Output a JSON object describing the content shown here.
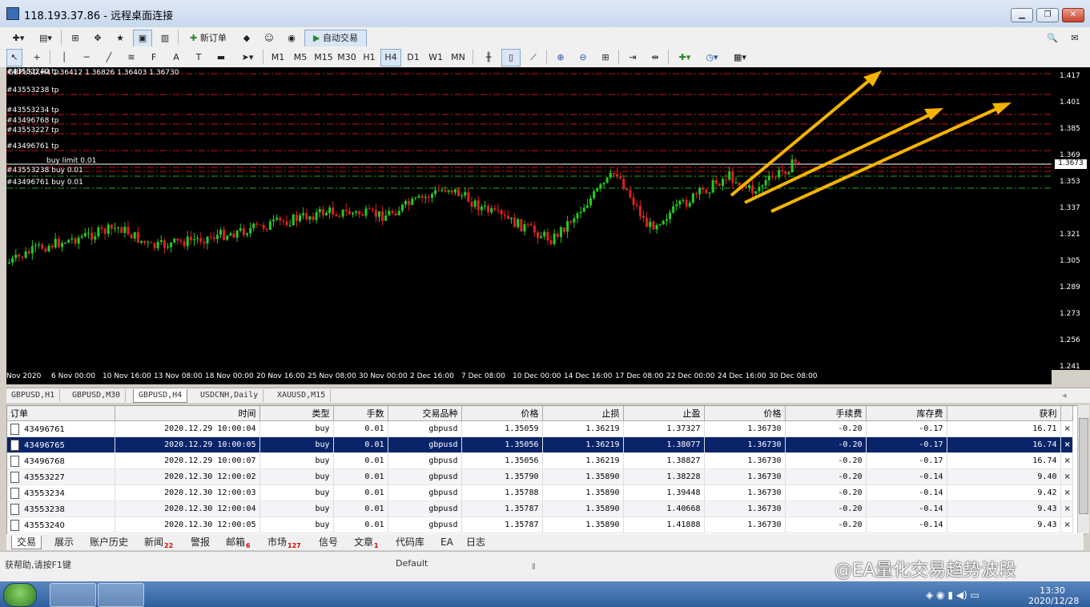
{
  "window": {
    "title": "118.193.37.86 - 远程桌面连接"
  },
  "toolbar1": {
    "new_order_label": "新订单",
    "auto_trade_label": "自动交易"
  },
  "toolbar2": {
    "timeframes": [
      "M1",
      "M5",
      "M15",
      "M30",
      "H1",
      "H4",
      "D1",
      "W1",
      "MN"
    ],
    "active_timeframe": "H4"
  },
  "chart": {
    "info": "GBPUSD,H4  1.36412 1.36826 1.36403 1.36730",
    "labels": {
      "l1": "#43553240 tp",
      "l2": "#43553238 tp",
      "l3": "#43553234 tp",
      "l4": "#43496768 tp",
      "l5": "#43553227 tp",
      "l6": "#43496761 tp",
      "l7": "buy limit 0.01",
      "l8": "#43553238 buy 0.01",
      "l9": "#43496761 buy 0.01"
    },
    "price_ticks": [
      "1.417",
      "1.401",
      "1.385",
      "1.369",
      "1.353",
      "1.337",
      "1.321",
      "1.305",
      "1.289",
      "1.273",
      "1.256",
      "1.241"
    ],
    "current_price": "1.3673",
    "time_ticks": [
      "Nov 2020",
      "6 Nov 00:00",
      "10 Nov 16:00",
      "13 Nov 08:00",
      "18 Nov 00:00",
      "20 Nov 16:00",
      "25 Nov 08:00",
      "30 Nov 00:00",
      "2 Dec 16:00",
      "7 Dec 08:00",
      "10 Dec 00:00",
      "14 Dec 16:00",
      "17 Dec 08:00",
      "22 Dec 00:00",
      "24 Dec 16:00",
      "30 Dec 08:00"
    ]
  },
  "chart_tabs": [
    "GBPUSD,H1",
    "GBPUSD,M30",
    "GBPUSD,H4",
    "USDCNH,Daily",
    "XAUUSD,M15"
  ],
  "chart_tabs_active": "GBPUSD,H4",
  "orders": {
    "headers": [
      "订单",
      "时间",
      "类型",
      "手数",
      "交易品种",
      "价格",
      "止损",
      "止盈",
      "价格",
      "手续费",
      "库存费",
      "获利"
    ],
    "rows": [
      [
        "43496761",
        "2020.12.29 10:00:04",
        "buy",
        "0.01",
        "gbpusd",
        "1.35059",
        "1.36219",
        "1.37327",
        "1.36730",
        "-0.20",
        "-0.17",
        "16.71"
      ],
      [
        "43496765",
        "2020.12.29 10:00:05",
        "buy",
        "0.01",
        "gbpusd",
        "1.35056",
        "1.36219",
        "1.38077",
        "1.36730",
        "-0.20",
        "-0.17",
        "16.74"
      ],
      [
        "43496768",
        "2020.12.29 10:00:07",
        "buy",
        "0.01",
        "gbpusd",
        "1.35056",
        "1.36219",
        "1.38827",
        "1.36730",
        "-0.20",
        "-0.17",
        "16.74"
      ],
      [
        "43553227",
        "2020.12.30 12:00:02",
        "buy",
        "0.01",
        "gbpusd",
        "1.35790",
        "1.35890",
        "1.38228",
        "1.36730",
        "-0.20",
        "-0.14",
        "9.40"
      ],
      [
        "43553234",
        "2020.12.30 12:00:03",
        "buy",
        "0.01",
        "gbpusd",
        "1.35788",
        "1.35890",
        "1.39448",
        "1.36730",
        "-0.20",
        "-0.14",
        "9.42"
      ],
      [
        "43553238",
        "2020.12.30 12:00:04",
        "buy",
        "0.01",
        "gbpusd",
        "1.35787",
        "1.35890",
        "1.40668",
        "1.36730",
        "-0.20",
        "-0.14",
        "9.43"
      ],
      [
        "43553240",
        "2020.12.30 12:00:05",
        "buy",
        "0.01",
        "gbpusd",
        "1.35787",
        "1.35890",
        "1.41888",
        "1.36730",
        "-0.20",
        "-0.14",
        "9.43"
      ]
    ],
    "selected_row": 1,
    "close_glyph": "×"
  },
  "terminal_tabs": {
    "trade": "交易",
    "exposure": "展示",
    "history": "账户历史",
    "news": "新闻",
    "news_badge": "22",
    "alerts": "警报",
    "mailbox": "邮箱",
    "mailbox_badge": "6",
    "market": "市场",
    "market_badge": "127",
    "signals": "信号",
    "articles": "文章",
    "articles_badge": "1",
    "codebase": "代码库",
    "ea": "EA",
    "journal": "日志"
  },
  "statusbar": {
    "help": "获帮助,请按F1键",
    "profile": "Default"
  },
  "watermark": "@EA量化交易趋势波段",
  "taskbar": {
    "time": "13:30",
    "date": "2020/12/28"
  }
}
